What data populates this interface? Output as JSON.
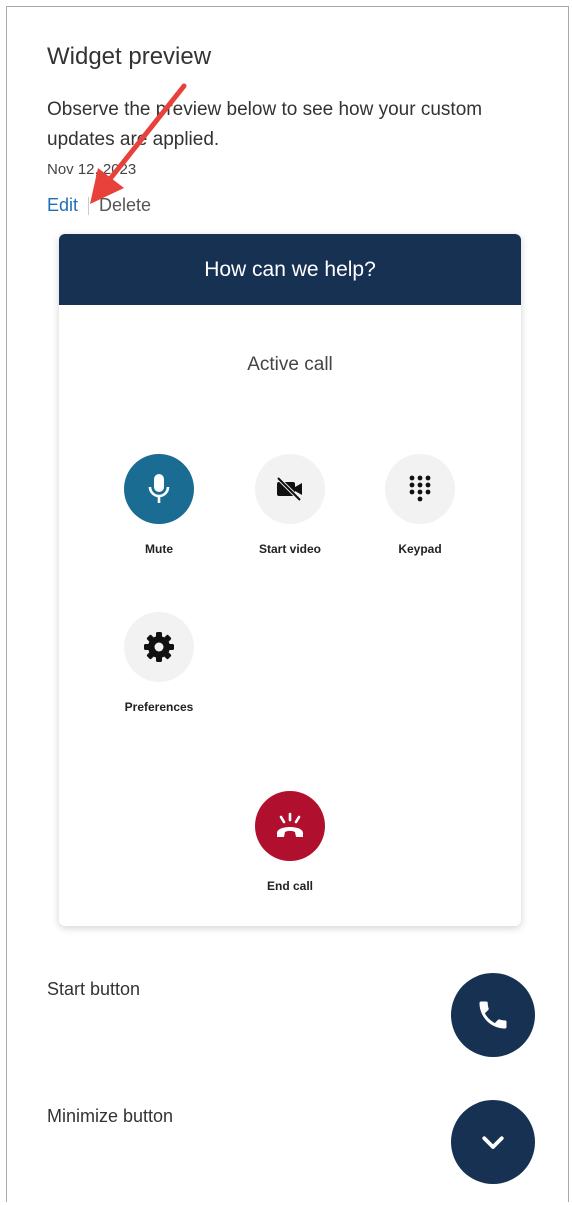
{
  "preview": {
    "title": "Widget preview",
    "description": "Observe the preview below to see how your custom updates are applied.",
    "date": "Nov 12, 2023",
    "edit_label": "Edit",
    "delete_label": "Delete"
  },
  "widget": {
    "header": "How can we help?",
    "status": "Active call",
    "controls": {
      "mute": "Mute",
      "start_video": "Start video",
      "keypad": "Keypad",
      "preferences": "Preferences",
      "end_call": "End call"
    }
  },
  "buttons": {
    "start_label": "Start button",
    "minimize_label": "Minimize button"
  },
  "colors": {
    "header": "#163152",
    "mute": "#1a6c92",
    "end_call": "#b0102e",
    "link": "#1f6fb8",
    "annotation_arrow": "#e8403a"
  },
  "icons": {
    "mute": "microphone-icon",
    "start_video": "video-off-icon",
    "keypad": "keypad-icon",
    "preferences": "gear-icon",
    "end_call": "hang-up-icon",
    "start": "phone-icon",
    "minimize": "chevron-down-icon"
  }
}
